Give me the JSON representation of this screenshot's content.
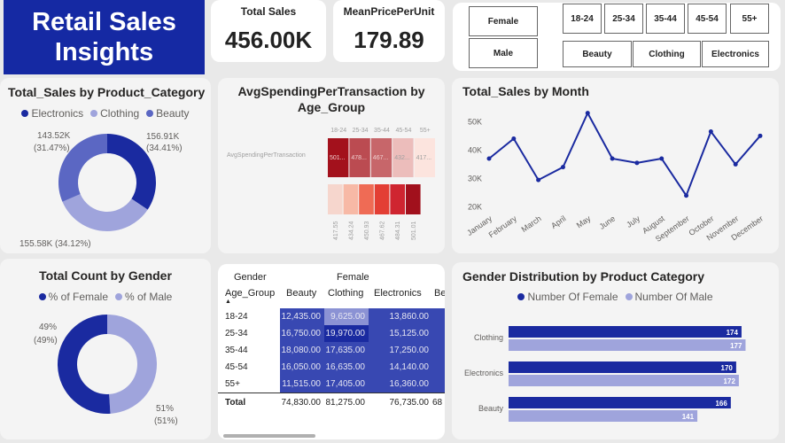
{
  "title": [
    "Retail Sales",
    "Insights"
  ],
  "kpis": {
    "total_sales": {
      "label": "Total Sales",
      "value": "456.00K"
    },
    "mean_price": {
      "label": "MeanPricePerUnit",
      "value": "179.89"
    }
  },
  "slicers": {
    "gender": [
      "Female",
      "Male"
    ],
    "age": [
      "18-24",
      "25-34",
      "35-44",
      "45-54",
      "55+"
    ],
    "category": [
      "Beauty",
      "Clothing",
      "Electronics"
    ]
  },
  "colors": {
    "navy": "#1a2aa0",
    "light": "#9fa4dc",
    "mid": "#5b67c3",
    "title_bg": "#1529a3"
  },
  "panels": {
    "cat_donut": {
      "title": "Total_Sales by Product_Category",
      "legend": [
        "Electronics",
        "Clothing",
        "Beauty"
      ],
      "labels": [
        [
          "156.91K",
          "(34.41%)"
        ],
        [
          "155.58K (34.12%)"
        ],
        [
          "143.52K",
          "(31.47%)"
        ]
      ]
    },
    "gender_donut": {
      "title": "Total Count by Gender",
      "legend": [
        "% of Female",
        "% of Male"
      ],
      "labels": [
        [
          "49%",
          "(49%)"
        ],
        [
          "51%",
          "(51%)"
        ]
      ]
    },
    "heat": {
      "title": [
        "AvgSpendingPerTransaction by",
        "Age_Group"
      ],
      "row_label": "AvgSpendingPerTransaction"
    },
    "line": {
      "title": "Total_Sales by Month"
    },
    "matrix": {
      "corner": "Gender",
      "group": "Female",
      "row_header": "Age_Group",
      "sort_arrow": "▲",
      "columns": [
        "Beauty",
        "Clothing",
        "Electronics",
        "Be"
      ],
      "rows": [
        {
          "label": "18-24",
          "cells": [
            "12,435.00",
            "9,625.00",
            "13,860.00",
            ""
          ]
        },
        {
          "label": "25-34",
          "cells": [
            "16,750.00",
            "19,970.00",
            "15,125.00",
            ""
          ]
        },
        {
          "label": "35-44",
          "cells": [
            "18,080.00",
            "17,635.00",
            "17,250.00",
            ""
          ]
        },
        {
          "label": "45-54",
          "cells": [
            "16,050.00",
            "16,635.00",
            "14,140.00",
            ""
          ]
        },
        {
          "label": "55+",
          "cells": [
            "11,515.00",
            "17,405.00",
            "16,360.00",
            ""
          ]
        }
      ],
      "total": {
        "label": "Total",
        "cells": [
          "74,830.00",
          "81,275.00",
          "76,735.00",
          "68"
        ]
      }
    },
    "gbar": {
      "title": "Gender Distribution by Product Category",
      "legend": [
        "Number Of Female",
        "Number Of Male"
      ]
    }
  },
  "chart_data": [
    {
      "type": "pie",
      "title": "Total_Sales by Product_Category",
      "categories": [
        "Electronics",
        "Clothing",
        "Beauty"
      ],
      "values": [
        156.91,
        155.58,
        143.52
      ],
      "unit": "K",
      "percents": [
        34.41,
        34.12,
        31.47
      ],
      "colors": [
        "#1a2aa0",
        "#9fa4dc",
        "#5b67c3"
      ]
    },
    {
      "type": "pie",
      "title": "Total Count by Gender",
      "categories": [
        "% of Female",
        "% of Male"
      ],
      "values": [
        49,
        51
      ],
      "colors": [
        "#9fa4dc",
        "#1a2aa0"
      ]
    },
    {
      "type": "heatmap",
      "title": "AvgSpendingPerTransaction by Age_Group",
      "categories": [
        "18-24",
        "25-34",
        "35-44",
        "45-54",
        "55+"
      ],
      "values": [
        501.26,
        478.25,
        467.62,
        432.85,
        417.55
      ],
      "top_labels": [
        "501...",
        "478...",
        "467...",
        "432...",
        "417..."
      ],
      "bottom_categories": [
        "417.55",
        "434.24",
        "450.93",
        "467.62",
        "484.31",
        "501.01"
      ],
      "bottom_colors": [
        "#f6d6cd",
        "#f7b9a6",
        "#ef6b55",
        "#e33e34",
        "#cf2530",
        "#a1101c"
      ]
    },
    {
      "type": "line",
      "title": "Total_Sales by Month",
      "categories": [
        "January",
        "February",
        "March",
        "April",
        "May",
        "June",
        "July",
        "August",
        "September",
        "October",
        "November",
        "December"
      ],
      "values": [
        37000,
        44000,
        29500,
        34000,
        53000,
        37000,
        35500,
        37000,
        24000,
        46500,
        35000,
        45000
      ],
      "yticks": [
        20000,
        30000,
        40000,
        50000
      ],
      "ytick_labels": [
        "20K",
        "30K",
        "40K",
        "50K"
      ],
      "ylim": [
        18000,
        56000
      ],
      "color": "#1a2aa0"
    },
    {
      "type": "bar",
      "title": "Gender Distribution by Product Category",
      "categories": [
        "Clothing",
        "Electronics",
        "Beauty"
      ],
      "series": [
        {
          "name": "Number Of Female",
          "values": [
            174,
            170,
            166
          ],
          "color": "#1a2aa0"
        },
        {
          "name": "Number Of Male",
          "values": [
            177,
            172,
            141
          ],
          "color": "#9fa4dc"
        }
      ],
      "xlim": [
        0,
        180
      ]
    }
  ]
}
